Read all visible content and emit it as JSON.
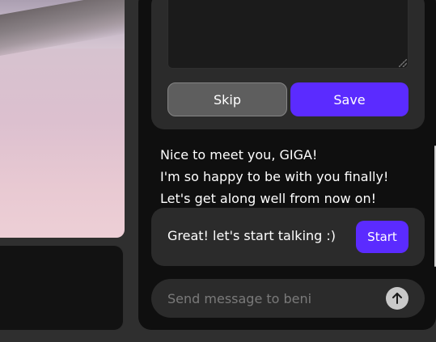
{
  "profile_form": {
    "skip_label": "Skip",
    "save_label": "Save"
  },
  "chat": {
    "bot_message_lines": [
      "Nice to meet you, GIGA!",
      "I'm so happy to be with you finally!",
      "Let's get along well from now on!"
    ],
    "suggestion": {
      "text": "Great! let's start talking :)",
      "start_label": "Start"
    },
    "composer": {
      "placeholder": "Send message to beni",
      "send_icon": "arrow-up-icon"
    }
  },
  "colors": {
    "accent": "#5b2bff",
    "card_bg": "#2b2b2b",
    "panel_bg": "#0f0f0f"
  }
}
